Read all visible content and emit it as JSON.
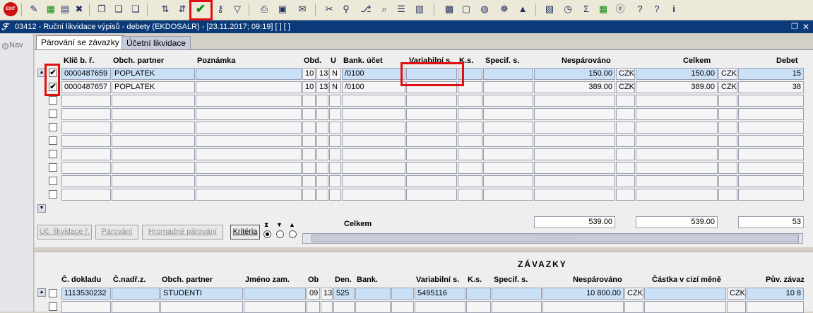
{
  "toolbar": {
    "icons": [
      "exit-icon",
      "wand-icon",
      "add-icon",
      "edit-icon",
      "delete-icon",
      "copy-icon",
      "copy-edit-icon",
      "copy-delete-icon",
      "sort-asc-icon",
      "sort-desc-icon",
      "check-icon",
      "key-icon",
      "filter-icon",
      "print-icon",
      "print-preview-icon",
      "mail-icon",
      "cut-icon",
      "link-icon",
      "tree-icon",
      "zoom-icon",
      "list-icon",
      "columns-icon",
      "calc-icon",
      "save-icon",
      "globe-icon",
      "wheel-icon",
      "chart-icon",
      "report-icon",
      "clock-icon",
      "sum-icon",
      "excel-icon",
      "ie-icon",
      "help-icon",
      "help2-icon",
      "info-icon"
    ],
    "exit_label": "EXIT",
    "sum_label": "Σ",
    "info_label": "i",
    "help_label": "?"
  },
  "window": {
    "title": "03412 - Ruční likvidace výpisů - debety (EKDOSALR) - [23.11.2017; 09:19]  [ ]  [ ]"
  },
  "nav": {
    "label": "Nav"
  },
  "tabs": [
    {
      "label": "Párování se závazky",
      "active": true
    },
    {
      "label": "Účetní likvidace",
      "active": false
    }
  ],
  "upper_table": {
    "columns": [
      "Klíč b. ř.",
      "Obch. partner",
      "Poznámka",
      "Obd.",
      "U",
      "Bank. účet",
      "Variabilní s.",
      "K.s.",
      "Specif. s.",
      "Nespárováno",
      "Celkem",
      "Debet"
    ],
    "rows": [
      {
        "checked": true,
        "key": "0000487659",
        "partner": "POPLATEK",
        "note": "",
        "obd1": "10",
        "obd2": "13",
        "u": "N",
        "account": "/0100",
        "vs": "",
        "ks": "",
        "ss": "",
        "unpaired": "150.00",
        "cur1": "CZK",
        "total": "150.00",
        "cur2": "CZK",
        "debet": "15"
      },
      {
        "checked": true,
        "key": "0000487657",
        "partner": "POPLATEK",
        "note": "",
        "obd1": "10",
        "obd2": "13",
        "u": "N",
        "account": "/0100",
        "vs": "",
        "ks": "",
        "ss": "",
        "unpaired": "389.00",
        "cur1": "CZK",
        "total": "389.00",
        "cur2": "CZK",
        "debet": "38"
      }
    ],
    "empty_rows": 8,
    "totals": {
      "label": "Celkem",
      "unpaired": "539.00",
      "total": "539.00",
      "debet": "53"
    }
  },
  "buttons": {
    "uc_likvidace": "Úč. likvidace ř.",
    "parovani": "Párování",
    "hromadne": "Hromadné párování",
    "kriteria": "Kritéria"
  },
  "lower_table": {
    "title": "ZÁVAZKY",
    "columns": [
      "Č. dokladu",
      "Č.nadř.z.",
      "Obch. partner",
      "Jméno zam.",
      "Ob",
      "Den.",
      "Bank.",
      "Variabilní s.",
      "K.s.",
      "Specif. s.",
      "Nespárováno",
      "Částka v cizí měně",
      "Pův. závaz"
    ],
    "rows": [
      {
        "checked": false,
        "doc": "1113530232",
        "parent": "",
        "partner": "STUDENTI",
        "emp": "",
        "ob1": "09",
        "ob2": "13",
        "den": "525",
        "bank": "",
        "vs": "5495116",
        "ks": "",
        "ss": "",
        "unpaired": "10 800.00",
        "cur1": "CZK",
        "foreign": "",
        "cur2": "CZK",
        "orig": "10 8"
      }
    ]
  }
}
